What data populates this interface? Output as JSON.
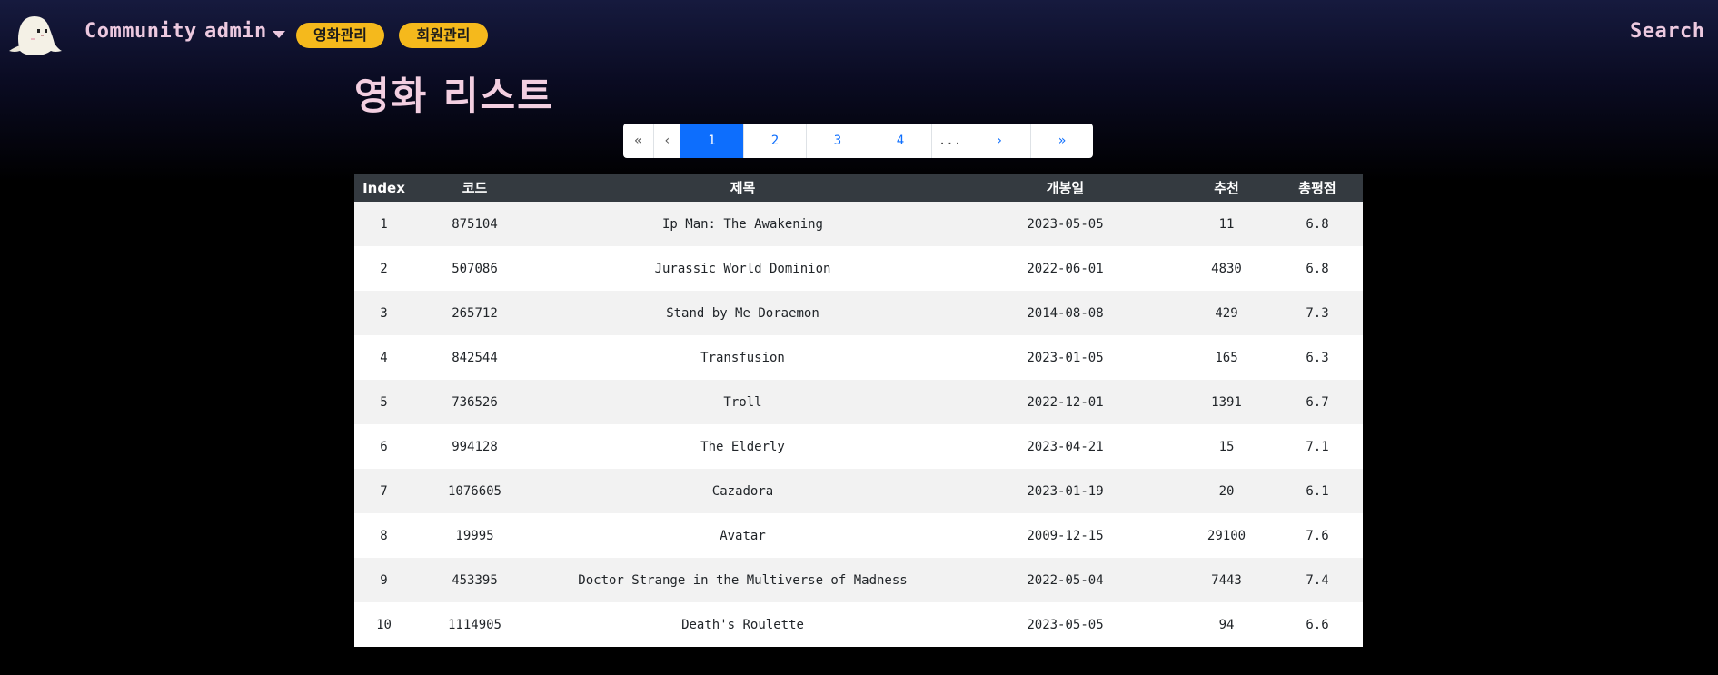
{
  "nav": {
    "community": "Community",
    "admin": "admin",
    "movie_manage": "영화관리",
    "member_manage": "회원관리",
    "search": "Search"
  },
  "page_title": "영화 리스트",
  "pagination": {
    "first": "«",
    "prev": "‹",
    "pages": [
      "1",
      "2",
      "3",
      "4"
    ],
    "active": "1",
    "ellipsis": "...",
    "next": "›",
    "last": "»"
  },
  "table": {
    "headers": [
      "Index",
      "코드",
      "제목",
      "개봉일",
      "추천",
      "총평점"
    ],
    "rows": [
      [
        "1",
        "875104",
        "Ip Man: The Awakening",
        "2023-05-05",
        "11",
        "6.8"
      ],
      [
        "2",
        "507086",
        "Jurassic World Dominion",
        "2022-06-01",
        "4830",
        "6.8"
      ],
      [
        "3",
        "265712",
        "Stand by Me Doraemon",
        "2014-08-08",
        "429",
        "7.3"
      ],
      [
        "4",
        "842544",
        "Transfusion",
        "2023-01-05",
        "165",
        "6.3"
      ],
      [
        "5",
        "736526",
        "Troll",
        "2022-12-01",
        "1391",
        "6.7"
      ],
      [
        "6",
        "994128",
        "The Elderly",
        "2023-04-21",
        "15",
        "7.1"
      ],
      [
        "7",
        "1076605",
        "Cazadora",
        "2023-01-19",
        "20",
        "6.1"
      ],
      [
        "8",
        "19995",
        "Avatar",
        "2009-12-15",
        "29100",
        "7.6"
      ],
      [
        "9",
        "453395",
        "Doctor Strange in the Multiverse of Madness",
        "2022-05-04",
        "7443",
        "7.4"
      ],
      [
        "10",
        "1114905",
        "Death's Roulette",
        "2023-05-05",
        "94",
        "6.6"
      ]
    ]
  },
  "colors": {
    "accent_pill": "#f5b91c",
    "nav_text": "#ecc9df",
    "active_page": "#0d6efd",
    "table_header": "#343a40"
  },
  "icons": {
    "logo": "ghost-logo-icon",
    "caret": "chevron-down-icon"
  }
}
